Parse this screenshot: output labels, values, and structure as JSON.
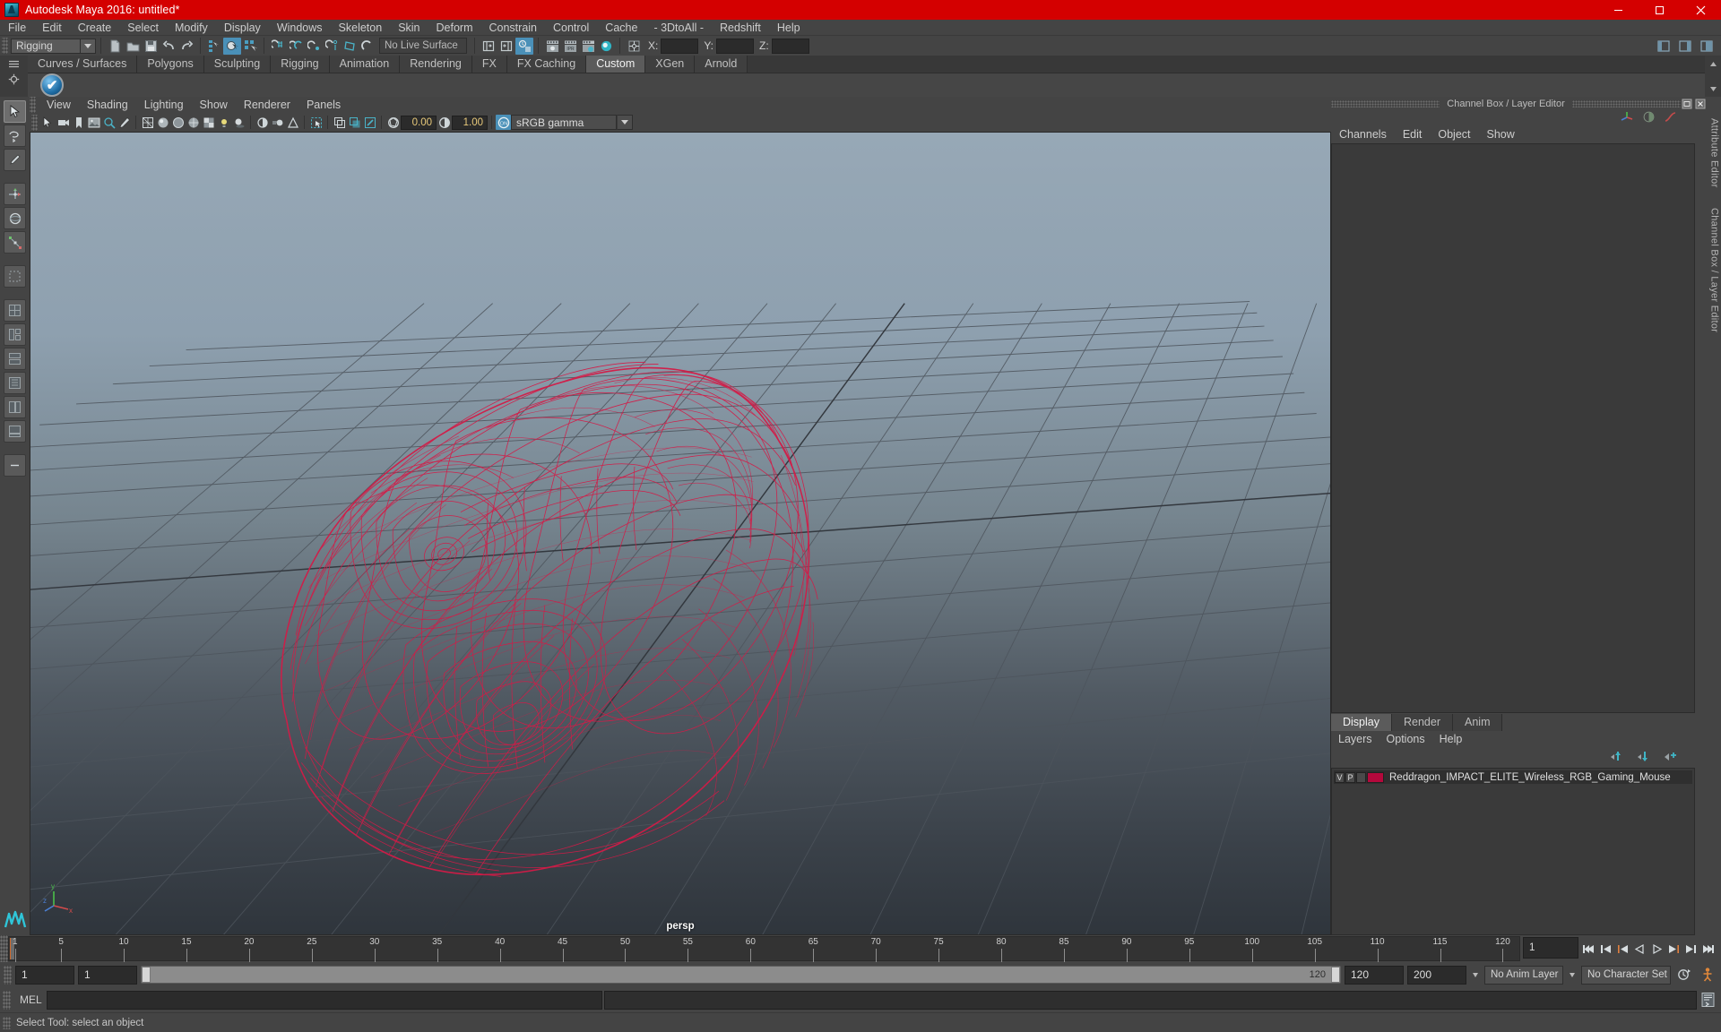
{
  "window": {
    "title": "Autodesk Maya 2016: untitled*",
    "minimize": "—",
    "maximize": "▢",
    "close": "✕"
  },
  "menubar": {
    "items": [
      {
        "label": "File"
      },
      {
        "label": "Edit"
      },
      {
        "label": "Create"
      },
      {
        "label": "Select"
      },
      {
        "label": "Modify"
      },
      {
        "label": "Display"
      },
      {
        "label": "Windows"
      },
      {
        "label": "Skeleton"
      },
      {
        "label": "Skin"
      },
      {
        "label": "Deform"
      },
      {
        "label": "Constrain"
      },
      {
        "label": "Control"
      },
      {
        "label": "Cache"
      },
      {
        "label": "- 3DtoAll -"
      },
      {
        "label": "Redshift"
      },
      {
        "label": "Help"
      }
    ]
  },
  "statusline": {
    "menu_set": "Rigging",
    "live_surface": "No Live Surface",
    "coord_x_label": "X:",
    "coord_y_label": "Y:",
    "coord_z_label": "Z:",
    "coord_x_value": "",
    "coord_y_value": "",
    "coord_z_value": ""
  },
  "shelf": {
    "tabs": [
      {
        "label": "Curves / Surfaces",
        "selected": false
      },
      {
        "label": "Polygons",
        "selected": false
      },
      {
        "label": "Sculpting",
        "selected": false
      },
      {
        "label": "Rigging",
        "selected": false
      },
      {
        "label": "Animation",
        "selected": false
      },
      {
        "label": "Rendering",
        "selected": false
      },
      {
        "label": "FX",
        "selected": false
      },
      {
        "label": "FX Caching",
        "selected": false
      },
      {
        "label": "Custom",
        "selected": true
      },
      {
        "label": "XGen",
        "selected": false
      },
      {
        "label": "Arnold",
        "selected": false
      }
    ]
  },
  "viewport": {
    "menus": [
      {
        "label": "View"
      },
      {
        "label": "Shading"
      },
      {
        "label": "Lighting"
      },
      {
        "label": "Show"
      },
      {
        "label": "Renderer"
      },
      {
        "label": "Panels"
      }
    ],
    "exposure_value": "0.00",
    "gamma_value": "1.00",
    "color_management": "sRGB gamma",
    "camera_label": "persp",
    "axis_x": "x",
    "axis_y": "y",
    "axis_z": "z",
    "model_color": "#d31b47",
    "grid_color": "#4a4f55"
  },
  "channel_box": {
    "panel_title": "Channel Box / Layer Editor",
    "menus": [
      {
        "label": "Channels"
      },
      {
        "label": "Edit"
      },
      {
        "label": "Object"
      },
      {
        "label": "Show"
      }
    ]
  },
  "layer_editor": {
    "tabs": [
      {
        "label": "Display",
        "selected": true
      },
      {
        "label": "Render",
        "selected": false
      },
      {
        "label": "Anim",
        "selected": false
      }
    ],
    "menus": [
      {
        "label": "Layers"
      },
      {
        "label": "Options"
      },
      {
        "label": "Help"
      }
    ],
    "layers": [
      {
        "visible": "V",
        "playback": "P",
        "shading": "",
        "color": "#b4083c",
        "name": "Reddragon_IMPACT_ELITE_Wireless_RGB_Gaming_Mouse"
      }
    ]
  },
  "right_tabs": [
    {
      "label": "Attribute Editor"
    },
    {
      "label": "Channel Box / Layer Editor"
    }
  ],
  "timeline": {
    "ticks": [
      {
        "value": "1",
        "pos": 0.4
      },
      {
        "value": "5",
        "pos": 3.45
      },
      {
        "value": "10",
        "pos": 7.6
      },
      {
        "value": "15",
        "pos": 11.75
      },
      {
        "value": "20",
        "pos": 15.9
      },
      {
        "value": "25",
        "pos": 20.05
      },
      {
        "value": "30",
        "pos": 24.2
      },
      {
        "value": "35",
        "pos": 28.35
      },
      {
        "value": "40",
        "pos": 32.5
      },
      {
        "value": "45",
        "pos": 36.65
      },
      {
        "value": "50",
        "pos": 40.8
      },
      {
        "value": "55",
        "pos": 44.95
      },
      {
        "value": "60",
        "pos": 49.1
      },
      {
        "value": "65",
        "pos": 53.25
      },
      {
        "value": "70",
        "pos": 57.4
      },
      {
        "value": "75",
        "pos": 61.55
      },
      {
        "value": "80",
        "pos": 65.7
      },
      {
        "value": "85",
        "pos": 69.85
      },
      {
        "value": "90",
        "pos": 74.0
      },
      {
        "value": "95",
        "pos": 78.15
      },
      {
        "value": "100",
        "pos": 82.3
      },
      {
        "value": "105",
        "pos": 86.45
      },
      {
        "value": "110",
        "pos": 90.6
      },
      {
        "value": "115",
        "pos": 94.75
      },
      {
        "value": "120",
        "pos": 98.9
      }
    ],
    "current_frame": "1"
  },
  "range_slider": {
    "start_field": "1",
    "playback_start_field": "1",
    "range_end_label": "120",
    "playback_end_field": "120",
    "end_field": "200",
    "anim_layer": "No Anim Layer",
    "character_set": "No Character Set"
  },
  "command_line": {
    "language": "MEL",
    "input_value": "",
    "output_value": ""
  },
  "help_line": {
    "message": "Select Tool: select an object"
  }
}
